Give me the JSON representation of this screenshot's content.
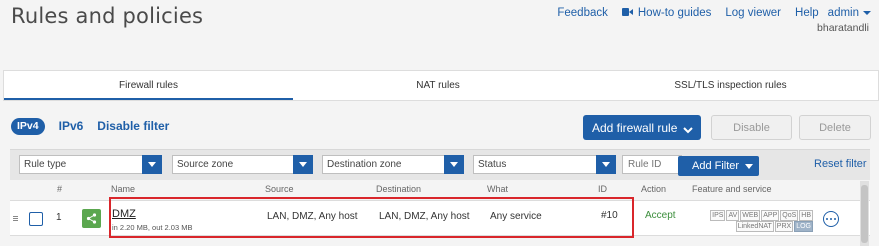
{
  "header": {
    "title": "Rules and policies",
    "links": {
      "feedback": "Feedback",
      "howto": "How-to guides",
      "logviewer": "Log viewer",
      "help": "Help",
      "admin": "admin"
    },
    "username": "bharatandli"
  },
  "tabs": [
    {
      "label": "Firewall rules"
    },
    {
      "label": "NAT rules"
    },
    {
      "label": "SSL/TLS inspection rules"
    }
  ],
  "versions": {
    "ipv4": "IPv4",
    "ipv6": "IPv6",
    "disable_filter": "Disable filter"
  },
  "actions": {
    "add_rule": "Add firewall rule",
    "disable": "Disable",
    "delete": "Delete"
  },
  "filters": {
    "rule_type": "Rule type",
    "source_zone": "Source zone",
    "destination_zone": "Destination zone",
    "status": "Status",
    "rule_id_placeholder": "Rule ID",
    "add_filter": "Add Filter",
    "reset_filter": "Reset filter"
  },
  "table": {
    "headers": {
      "num": "#",
      "name": "Name",
      "source": "Source",
      "destination": "Destination",
      "what": "What",
      "id": "ID",
      "action": "Action",
      "feature": "Feature and service"
    },
    "rows": [
      {
        "num": "1",
        "name": "DMZ",
        "traffic": "in 2.20 MB, out 2.03 MB",
        "source": "LAN, DMZ, Any host",
        "destination": "LAN, DMZ, Any host",
        "what": "Any service",
        "id": "#10",
        "action": "Accept",
        "features_row1": [
          "IPS",
          "AV",
          "WEB",
          "APP",
          "QoS",
          "HB"
        ],
        "features_row2": [
          "LinkedNAT",
          "PRX",
          "LOG"
        ]
      }
    ]
  },
  "colors": {
    "accent": "#1f5fa8",
    "accept": "#3c8e3c",
    "highlight": "#d9262b"
  }
}
